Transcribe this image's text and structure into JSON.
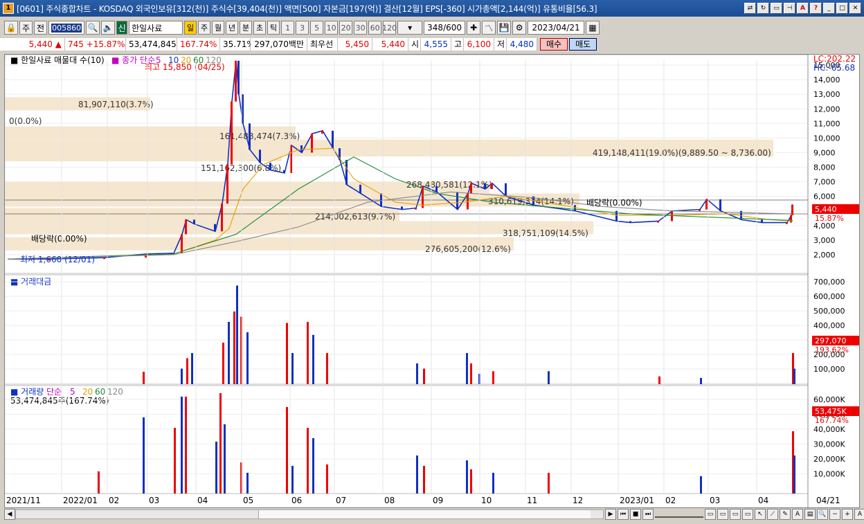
{
  "window": {
    "title": "[0601] 주식종합차트 - KOSDAQ 외국인보유[312(천)] 주식수[39,404(천)] 액면[500] 자본금[197(억)] 결산[12월] EPS[-360] 시가총액[2,144(억)] 유통비율[56.3]"
  },
  "toolbar": {
    "market": "주",
    "prefix": "전",
    "code": "005860",
    "stock_name": "한일사료",
    "name_tag": "신",
    "periods": [
      "일",
      "주",
      "월",
      "년",
      "분",
      "초",
      "틱"
    ],
    "active_period": "일",
    "intervals": [
      "1",
      "3",
      "5",
      "10",
      "20",
      "30",
      "60",
      "120"
    ],
    "count": "348",
    "count_max": "/600",
    "date": "2023/04/21"
  },
  "quote": {
    "price": "5,440",
    "arrow": "▲",
    "change": "745",
    "change_pct": "+15.87%",
    "volume": "53,474,845",
    "vol_ratio": "167.74%",
    "turnover_rate": "35.71%",
    "amount": "297,070백만",
    "best_label": "최우선",
    "ask": "5,450",
    "bid": "5,440",
    "open_label": "시",
    "open": "4,555",
    "high_label": "고",
    "high": "6,100",
    "low_label": "저",
    "low": "4,480",
    "buy": "매수",
    "sell": "매도"
  },
  "price_pane": {
    "legend_title": "한일사료 매물대 수(10)",
    "legend_ma_label": "종가 단순",
    "legend_ma": [
      "5",
      "10",
      "20",
      "60",
      "120"
    ],
    "lc": "LC:202.22",
    "hc": "HC:-65.68",
    "max_label": "최고 15,850 (04/25)",
    "min_label": "최저 1,660 (12/01)",
    "dividend_labels": [
      "배당락(0.00%)",
      "배당락(0.00%)"
    ],
    "yticks": [
      "15,000",
      "14,000",
      "13,000",
      "12,000",
      "11,000",
      "10,000",
      "9,000",
      "8,000",
      "7,000",
      "6,000",
      "5,000",
      "4,000",
      "3,000",
      "2,000"
    ],
    "cur_price": "5,440",
    "cur_pct": "15.87%",
    "volume_profile": [
      {
        "label": "0(0.0%)"
      },
      {
        "label": "81,907,110(3.7%)"
      },
      {
        "label": "161,483,474(7.3%)"
      },
      {
        "label": "151,162,300(6.8%)"
      },
      {
        "label": "419,148,411(19.0%)(9,889.50 ~ 8,736.00)"
      },
      {
        "label": "268,480,581(12.1%)"
      },
      {
        "label": "310,619,374(14.1%)"
      },
      {
        "label": "214,002,613(9.7%)"
      },
      {
        "label": "318,751,109(14.5%)"
      },
      {
        "label": "276,605,200(12.6%)"
      }
    ]
  },
  "amount_pane": {
    "title": "거래대금",
    "yticks": [
      "700,000",
      "600,000",
      "500,000",
      "400,000",
      "300,000",
      "200,000",
      "100,000"
    ],
    "cur": "297,070",
    "cur_pct": "193.62%"
  },
  "volume_pane": {
    "title": "거래량",
    "ma_label": "단순",
    "ma": [
      "5",
      "20",
      "60",
      "120"
    ],
    "value_label": "53,474,845주(167.74%)",
    "yticks": [
      "60,000K",
      "50,000K",
      "40,000K",
      "30,000K",
      "20,000K",
      "10,000K"
    ],
    "cur": "53,475K",
    "cur_pct": "167.74%"
  },
  "xaxis": {
    "labels": [
      "2021/11",
      "2022/01",
      "02",
      "03",
      "04",
      "05",
      "06",
      "07",
      "08",
      "09",
      "10",
      "11",
      "12",
      "2023/01",
      "02",
      "03",
      "04"
    ],
    "end_label": "04/21"
  },
  "chart_data": {
    "type": "candlestick",
    "title": "한일사료",
    "price_range": [
      1000,
      16000
    ],
    "high_point": {
      "date": "04/25",
      "value": 15850
    },
    "low_point": {
      "date": "12/01",
      "value": 1660
    },
    "last_close": 5440
  }
}
